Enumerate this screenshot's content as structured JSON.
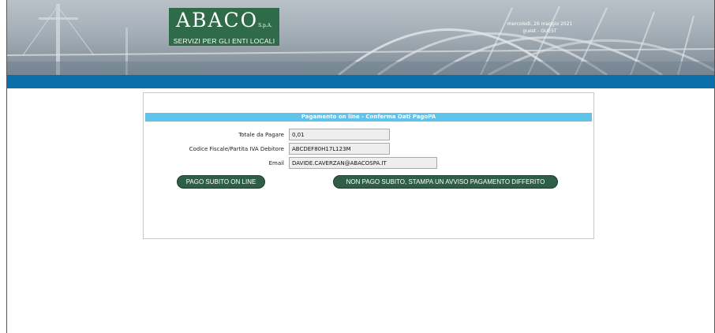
{
  "header": {
    "logo": {
      "main": "ABACO",
      "suffix": "S.p.A.",
      "subtitle": "SERVIZI PER GLI ENTI LOCALI"
    },
    "date": "mercoledì, 26 maggio 2021",
    "user": "guest - GUEST"
  },
  "form": {
    "title": "Pagamento on line - Conferma Dati PagoPA",
    "fields": [
      {
        "label": "Totale da Pagare",
        "value": "0,01"
      },
      {
        "label": "Codice Fiscale/Partita IVA Debitore",
        "value": "ABCDEF80H17L123M"
      },
      {
        "label": "Email",
        "value": "DAVIDE.CAVERZAN@ABACOSPA.IT"
      }
    ],
    "buttons": {
      "pay_now": "PAGO SUBITO ON LINE",
      "pay_later": "NON PAGO SUBITO, STAMPA UN AVVISO PAGAMENTO DIFFERITO"
    }
  },
  "colors": {
    "logo_bg": "#2f6b48",
    "header_strip": "#0a6fa8",
    "panel_title_bg": "#5ec4ec",
    "button_bg": "#2f5e46"
  }
}
